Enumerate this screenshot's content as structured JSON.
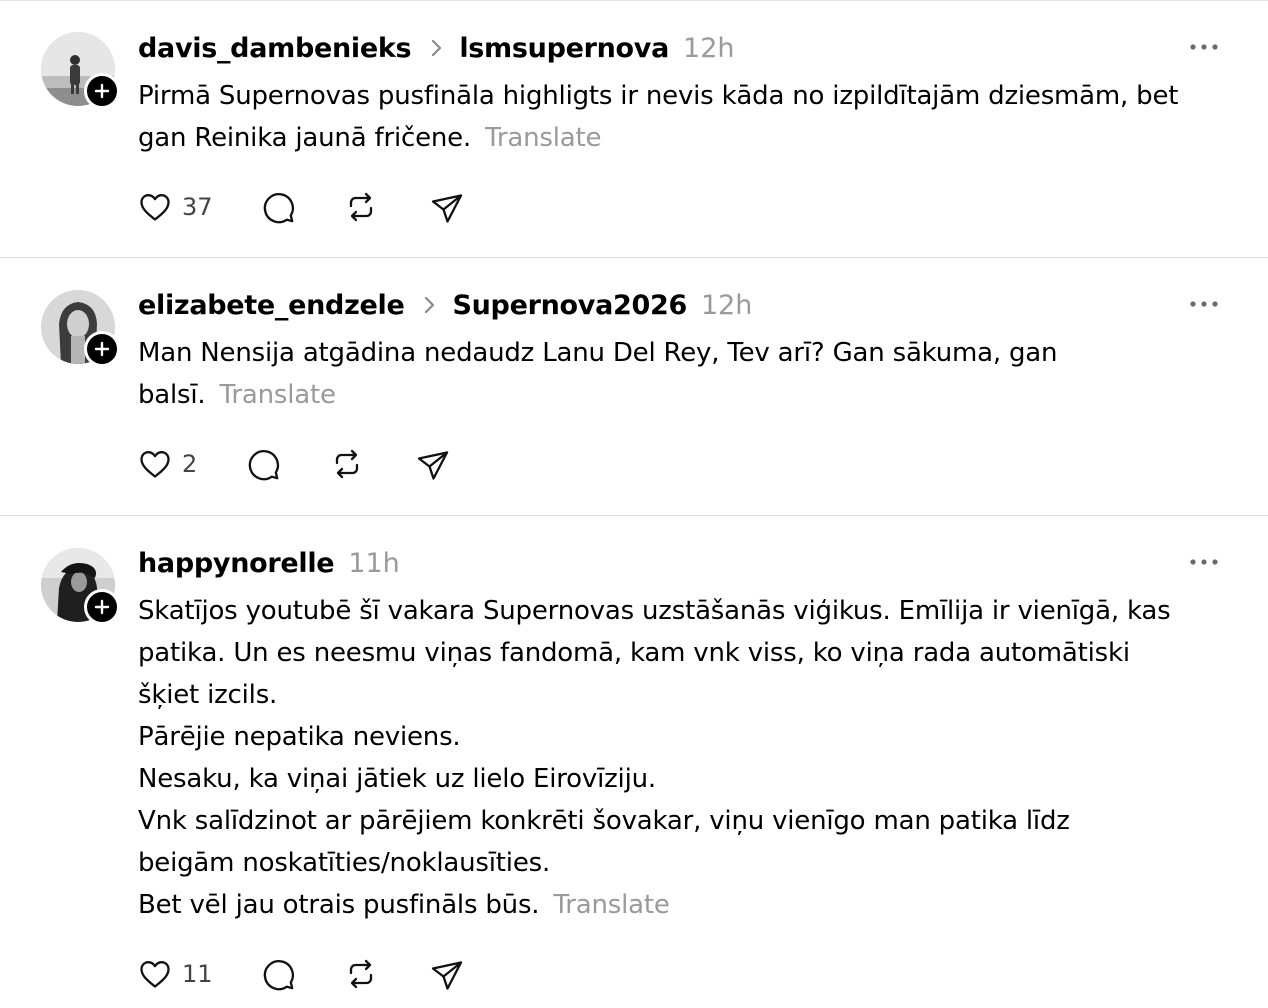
{
  "posts": [
    {
      "username": "davis_dambenieks",
      "community": "lsmsupernova",
      "time": "12h",
      "lines": [
        "Pirmā Supernovas pusfināla highligts ir nevis kāda no izpildītajām dziesmām, bet",
        "gan Reinika jaunā fričene."
      ],
      "translate": "Translate",
      "likes": "37",
      "avatar": "person-standing-landscape"
    },
    {
      "username": "elizabete_endzele",
      "community": "Supernova2026",
      "time": "12h",
      "lines": [
        "Man Nensija atgādina nedaudz Lanu Del Rey, Tev arī? Gan sākuma, gan",
        "balsī."
      ],
      "translate": "Translate",
      "likes": "2",
      "avatar": "woman-portrait"
    },
    {
      "username": "happynorelle",
      "community": "",
      "time": "11h",
      "lines": [
        "Skatījos youtubē šī vakara Supernovas uzstāšanās viģikus. Emīlija ir vienīgā, kas",
        "patika. Un es neesmu viņas fandomā, kam vnk viss, ko viņa rada automātiski",
        "šķiet izcils.",
        "Pārējie nepatika neviens.",
        "Nesaku, ka viņai jātiek uz lielo Eirovīziju.",
        "Vnk salīdzinot ar pārējiem konkrēti šovakar, viņu vienīgo man patika līdz",
        "beigām noskatīties/noklausīties.",
        "Bet vēl jau otrais pusfināls būs."
      ],
      "translate": "Translate",
      "likes": "11",
      "avatar": "person-dark-portrait"
    }
  ],
  "icons": {
    "like": "heart-icon",
    "reply": "comment-icon",
    "repost": "repost-icon",
    "share": "send-icon",
    "more": "more-icon",
    "follow": "plus-icon",
    "chevron": "chevron-right-icon"
  },
  "colors": {
    "text": "#000000",
    "muted": "#9a9a9a",
    "divider": "#dcdcdc",
    "background": "#ffffff"
  }
}
